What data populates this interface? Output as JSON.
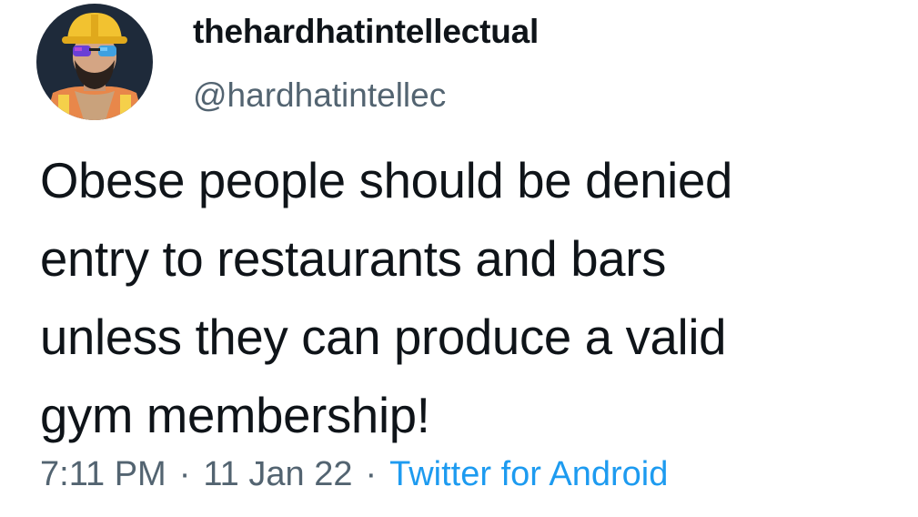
{
  "author": {
    "display_name": "thehardhatintellectual",
    "handle": "@hardhatintellec",
    "avatar_icon": "hardhat-man-avatar"
  },
  "tweet": {
    "text": "Obese people should be denied\nentry to restaurants and bars\nunless they can produce a valid\ngym membership!",
    "time": "7:11 PM",
    "date": "11 Jan 22",
    "separator": "·",
    "source": "Twitter for Android"
  },
  "colors": {
    "text": "#0f1419",
    "muted": "#536471",
    "link": "#1d9bf0",
    "avatar_bg": "#1e2a3a",
    "hardhat": "#f2c230"
  }
}
